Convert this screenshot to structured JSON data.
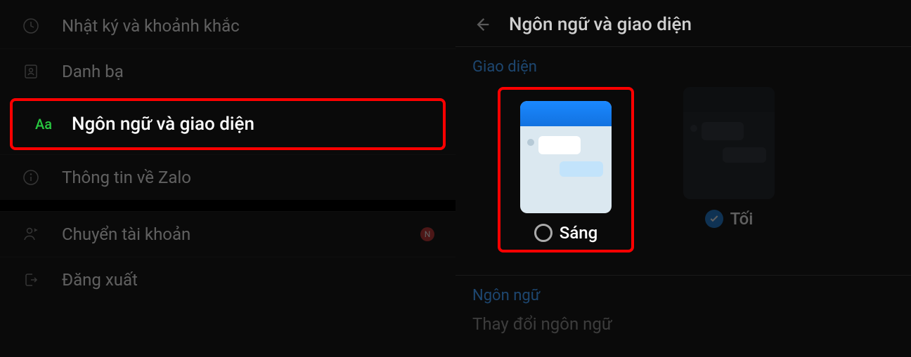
{
  "left": {
    "items": [
      {
        "label": "Nhật ký và khoảnh khắc"
      },
      {
        "label": "Danh bạ"
      },
      {
        "label": "Ngôn ngữ và giao diện",
        "aa": "Aa"
      },
      {
        "label": "Thông tin về Zalo"
      },
      {
        "label": "Chuyển tài khoản",
        "badge": "N"
      },
      {
        "label": "Đăng xuất"
      }
    ]
  },
  "right": {
    "title": "Ngôn ngữ và giao diện",
    "section_theme": "Giao diện",
    "section_lang": "Ngôn ngữ",
    "theme_light": "Sáng",
    "theme_dark": "Tối",
    "change_lang": "Thay đổi ngôn ngữ"
  }
}
